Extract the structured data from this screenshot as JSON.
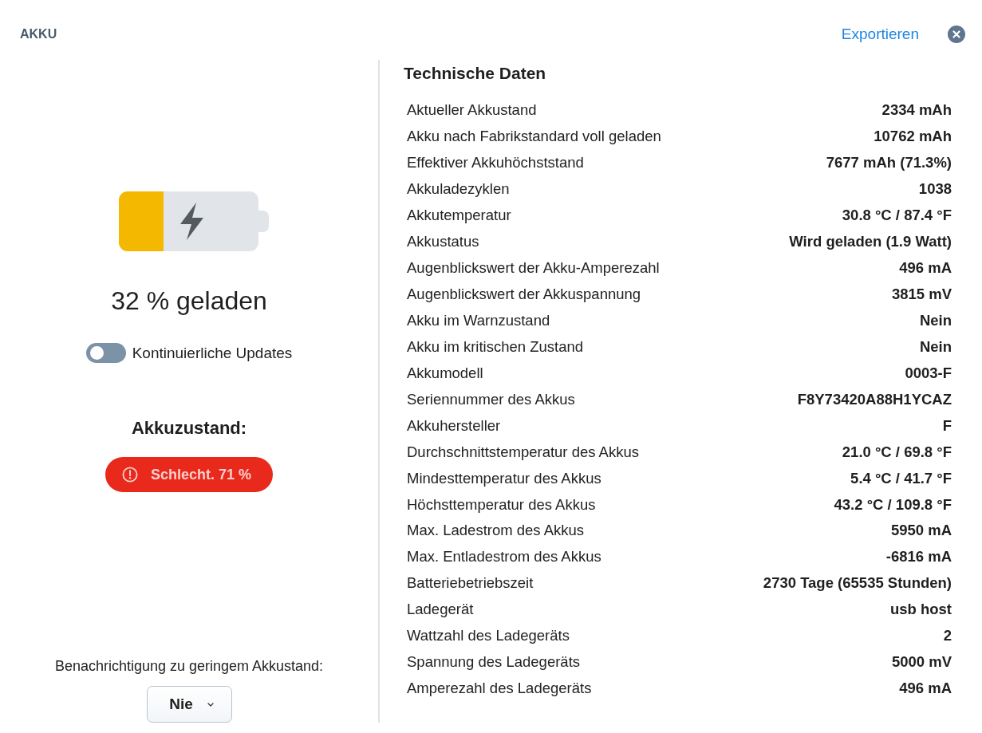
{
  "header": {
    "title": "AKKU",
    "export_link": "Exportieren"
  },
  "battery": {
    "level": 0.32,
    "charging": true,
    "charge_text": "32 % geladen"
  },
  "continuous_updates": {
    "label": "Kontinuierliche Updates",
    "on": false
  },
  "health": {
    "heading": "Akkuzustand:",
    "status": "Schlecht. 71 %",
    "warning": true
  },
  "low_battery_notification": {
    "label": "Benachrichtigung zu geringem Akkustand:",
    "value": "Nie"
  },
  "specs": {
    "title": "Technische Daten",
    "rows": [
      {
        "label": "Aktueller Akkustand",
        "value": "2334 mAh"
      },
      {
        "label": "Akku nach Fabrikstandard voll geladen",
        "value": "10762 mAh"
      },
      {
        "label": "Effektiver Akkuhöchststand",
        "value": "7677 mAh (71.3%)"
      },
      {
        "label": "Akkuladezyklen",
        "value": "1038"
      },
      {
        "label": "Akkutemperatur",
        "value": "30.8 °C / 87.4 °F"
      },
      {
        "label": "Akkustatus",
        "value": "Wird geladen (1.9 Watt)"
      },
      {
        "label": "Augenblickswert der Akku-Amperezahl",
        "value": "496 mA"
      },
      {
        "label": "Augenblickswert der Akkuspannung",
        "value": "3815 mV"
      },
      {
        "label": "Akku im Warnzustand",
        "value": "Nein"
      },
      {
        "label": "Akku im kritischen Zustand",
        "value": "Nein"
      },
      {
        "label": "Akkumodell",
        "value": "0003-F"
      },
      {
        "label": "Seriennummer des Akkus",
        "value": "F8Y73420A88H1YCAZ"
      },
      {
        "label": "Akkuhersteller",
        "value": "F"
      },
      {
        "label": "Durchschnittstemperatur des Akkus",
        "value": "21.0 °C / 69.8 °F"
      },
      {
        "label": "Mindesttemperatur des Akkus",
        "value": "5.4 °C / 41.7 °F"
      },
      {
        "label": "Höchsttemperatur des Akkus",
        "value": "43.2 °C / 109.8 °F"
      },
      {
        "label": "Max. Ladestrom des Akkus",
        "value": "5950 mA"
      },
      {
        "label": "Max. Entladestrom des Akkus",
        "value": "-6816 mA"
      },
      {
        "label": "Batteriebetriebszeit",
        "value": "2730 Tage (65535 Stunden)"
      },
      {
        "label": "Ladegerät",
        "value": "usb host"
      },
      {
        "label": "Wattzahl des Ladegeräts",
        "value": "2"
      },
      {
        "label": "Spannung des Ladegeräts",
        "value": "5000 mV"
      },
      {
        "label": "Amperezahl des Ladegeräts",
        "value": "496 mA"
      }
    ]
  }
}
